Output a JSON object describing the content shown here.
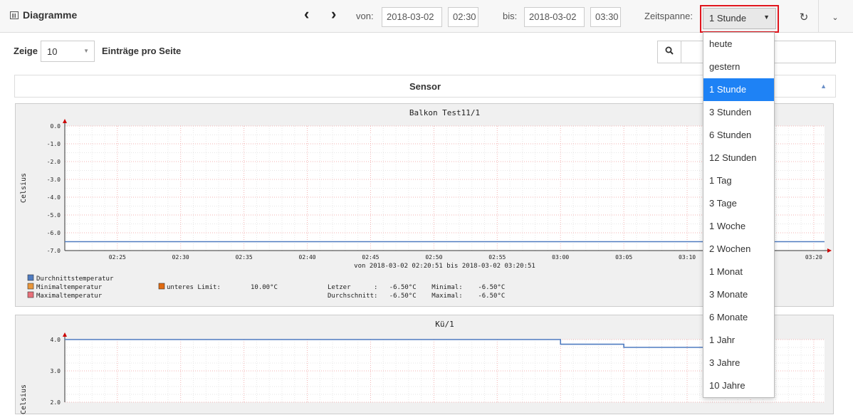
{
  "header": {
    "title": "Diagramme",
    "von_label": "von:",
    "von_date": "2018-03-02",
    "von_time": "02:30",
    "bis_label": "bis:",
    "bis_date": "2018-03-02",
    "bis_time": "03:30",
    "zeitspanne_label": "Zeitspanne:",
    "zeitspanne_value": "1 Stunde"
  },
  "table": {
    "zeige_label": "Zeige",
    "per_page": "10",
    "entries_label": "Einträge pro Seite",
    "column_header": "Sensor"
  },
  "dropdown": {
    "options": [
      "heute",
      "gestern",
      "1 Stunde",
      "3 Stunden",
      "6 Stunden",
      "12 Stunden",
      "1 Tag",
      "3 Tage",
      "1 Woche",
      "2 Wochen",
      "1 Monat",
      "3 Monate",
      "6 Monate",
      "1 Jahr",
      "3 Jahre",
      "10 Jahre"
    ],
    "selected": "1 Stunde"
  },
  "colors": {
    "accent": "#1e82f5",
    "highlight": "#e0151d",
    "line": "#4f7bc0"
  },
  "chart_data": [
    {
      "type": "line",
      "title": "Balkon Test11/1",
      "ylabel": "Celsius",
      "xlabel": "von 2018-03-02 02:20:51 bis 2018-03-02 03:20:51",
      "y_ticks": [
        "0.0",
        "-1.0",
        "-2.0",
        "-3.0",
        "-4.0",
        "-5.0",
        "-6.0",
        "-7.0"
      ],
      "ylim": [
        -7.0,
        0.0
      ],
      "x_ticks": [
        "02:25",
        "02:30",
        "02:35",
        "02:40",
        "02:45",
        "02:50",
        "02:55",
        "03:00",
        "03:05",
        "03:10",
        "03:20"
      ],
      "series": [
        {
          "name": "Durchnittstemperatur",
          "x": [
            "02:20:51",
            "03:20:51"
          ],
          "values": [
            -6.5,
            -6.5
          ]
        }
      ],
      "legend": {
        "entries": [
          "Durchnittstemperatur",
          "Minimaltemperatur",
          "Maximaltemperatur"
        ],
        "limit_label": "unteres Limit:",
        "limit_value": "10.00°C",
        "stats_line1": "Letzer      :   -6.50°C    Minimal:    -6.50°C",
        "stats_line2": "Durchschnitt:   -6.50°C    Maximal:    -6.50°C"
      }
    },
    {
      "type": "line",
      "title": "Kü/1",
      "ylabel": "Celsius",
      "y_ticks": [
        "4.0",
        "3.0",
        "2.0"
      ],
      "ylim": [
        2.0,
        4.0
      ],
      "series": [
        {
          "name": "",
          "x": [
            "02:20:51",
            "03:00",
            "03:00",
            "03:05",
            "03:05",
            "03:10"
          ],
          "values": [
            4.0,
            4.0,
            3.85,
            3.85,
            3.75,
            3.75
          ]
        }
      ]
    }
  ]
}
